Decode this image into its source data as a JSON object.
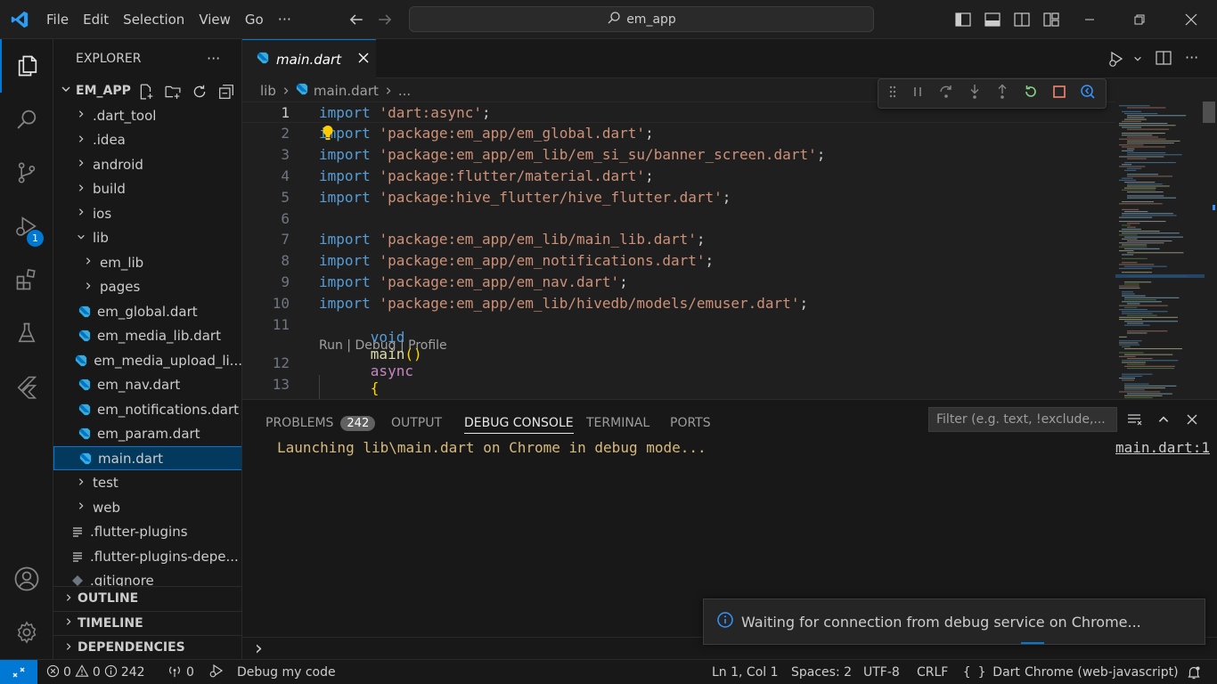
{
  "titlebar": {
    "menus": [
      "File",
      "Edit",
      "Selection",
      "View",
      "Go"
    ],
    "more": "···",
    "search": "em_app"
  },
  "activity": {
    "debug_badge": "1"
  },
  "explorer": {
    "title": "EXPLORER",
    "more": "···",
    "project": "EM_APP",
    "items": [
      {
        "label": ".dart_tool",
        "type": "folder",
        "depth": 1
      },
      {
        "label": ".idea",
        "type": "folder",
        "depth": 1
      },
      {
        "label": "android",
        "type": "folder",
        "depth": 1
      },
      {
        "label": "build",
        "type": "folder",
        "depth": 1
      },
      {
        "label": "ios",
        "type": "folder",
        "depth": 1
      },
      {
        "label": "lib",
        "type": "folder-open",
        "depth": 1
      },
      {
        "label": "em_lib",
        "type": "folder",
        "depth": 2
      },
      {
        "label": "pages",
        "type": "folder",
        "depth": 2
      },
      {
        "label": "em_global.dart",
        "type": "dart",
        "depth": 2
      },
      {
        "label": "em_media_lib.dart",
        "type": "dart",
        "depth": 2
      },
      {
        "label": "em_media_upload_li...",
        "type": "dart",
        "depth": 2
      },
      {
        "label": "em_nav.dart",
        "type": "dart",
        "depth": 2
      },
      {
        "label": "em_notifications.dart",
        "type": "dart",
        "depth": 2
      },
      {
        "label": "em_param.dart",
        "type": "dart",
        "depth": 2
      },
      {
        "label": "main.dart",
        "type": "dart",
        "depth": 2,
        "selected": true
      },
      {
        "label": "test",
        "type": "folder",
        "depth": 1
      },
      {
        "label": "web",
        "type": "folder",
        "depth": 1
      },
      {
        "label": ".flutter-plugins",
        "type": "text",
        "depth": 1
      },
      {
        "label": ".flutter-plugins-depe...",
        "type": "text",
        "depth": 1
      },
      {
        "label": ".gitignore",
        "type": "git",
        "depth": 1
      }
    ],
    "sections": [
      "OUTLINE",
      "TIMELINE",
      "DEPENDENCIES"
    ]
  },
  "editor": {
    "tab": "main.dart",
    "breadcrumb": [
      "lib",
      "main.dart",
      "..."
    ],
    "codelens": "Run | Debug | Profile",
    "lines": [
      {
        "n": "1",
        "kw": "import",
        "str": "'dart:async'",
        "end": ";"
      },
      {
        "n": "2",
        "kw": "import",
        "str": "'package:em_app/em_global.dart'",
        "end": ";"
      },
      {
        "n": "3",
        "kw": "import",
        "str": "'package:em_app/em_lib/em_si_su/banner_screen.dart'",
        "end": ";"
      },
      {
        "n": "4",
        "kw": "import",
        "str": "'package:flutter/material.dart'",
        "end": ";"
      },
      {
        "n": "5",
        "kw": "import",
        "str": "'package:hive_flutter/hive_flutter.dart'",
        "end": ";"
      },
      {
        "n": "6",
        "kw": "",
        "str": "",
        "end": ""
      },
      {
        "n": "7",
        "kw": "import",
        "str": "'package:em_app/em_lib/main_lib.dart'",
        "end": ";"
      },
      {
        "n": "8",
        "kw": "import",
        "str": "'package:em_app/em_notifications.dart'",
        "end": ";"
      },
      {
        "n": "9",
        "kw": "import",
        "str": "'package:em_app/em_nav.dart'",
        "end": ";"
      },
      {
        "n": "10",
        "kw": "import",
        "str": "'package:em_app/em_lib/hivedb/models/emuser.dart'",
        "end": ";"
      },
      {
        "n": "11",
        "kw": "",
        "str": "",
        "end": ""
      }
    ],
    "main_line": {
      "n": "12",
      "void": "void",
      "fn": "main",
      "parens": "()",
      "async": "async",
      "brace": "{"
    },
    "empty_line_n": "13"
  },
  "panel": {
    "tabs": [
      "PROBLEMS",
      "OUTPUT",
      "DEBUG CONSOLE",
      "TERMINAL",
      "PORTS"
    ],
    "problems_count": "242",
    "filter_placeholder": "Filter (e.g. text, !exclude,...",
    "console_line": "Launching lib\\main.dart on Chrome in debug mode...",
    "console_source": "main.dart:1",
    "prompt": "›"
  },
  "notification": {
    "text": "Waiting for connection from debug service on Chrome..."
  },
  "statusbar": {
    "errors": "0",
    "warnings": "0",
    "info": "242",
    "ports": "0",
    "launch": "Debug my code",
    "position": "Ln 1, Col 1",
    "spaces": "Spaces: 2",
    "encoding": "UTF-8",
    "eol": "CRLF",
    "language": "Dart",
    "device": "Chrome (web-javascript)"
  },
  "colors": {
    "accent": "#0078d4",
    "background": "#1f1f1f",
    "sidebar": "#181818",
    "keyword": "#569cd6",
    "string": "#ce9178",
    "console_text": "#d7ba7d"
  }
}
